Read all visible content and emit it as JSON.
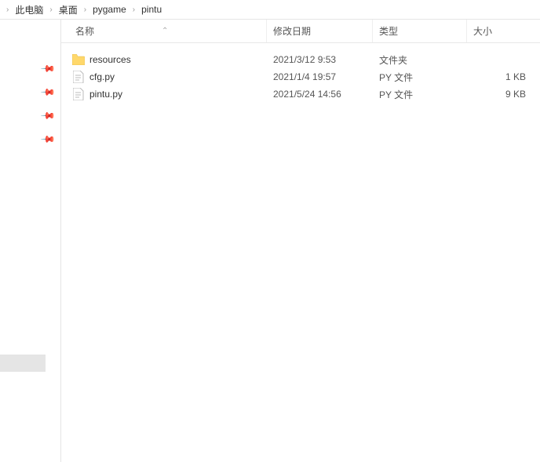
{
  "breadcrumb": {
    "items": [
      {
        "label": "此电脑"
      },
      {
        "label": "桌面"
      },
      {
        "label": "pygame"
      },
      {
        "label": "pintu"
      }
    ]
  },
  "columns": {
    "name": "名称",
    "date": "修改日期",
    "type": "类型",
    "size": "大小"
  },
  "files": [
    {
      "name": "resources",
      "date": "2021/3/12 9:53",
      "type": "文件夹",
      "size": "",
      "kind": "folder"
    },
    {
      "name": "cfg.py",
      "date": "2021/1/4 19:57",
      "type": "PY 文件",
      "size": "1 KB",
      "kind": "file"
    },
    {
      "name": "pintu.py",
      "date": "2021/5/24 14:56",
      "type": "PY 文件",
      "size": "9 KB",
      "kind": "file"
    }
  ]
}
